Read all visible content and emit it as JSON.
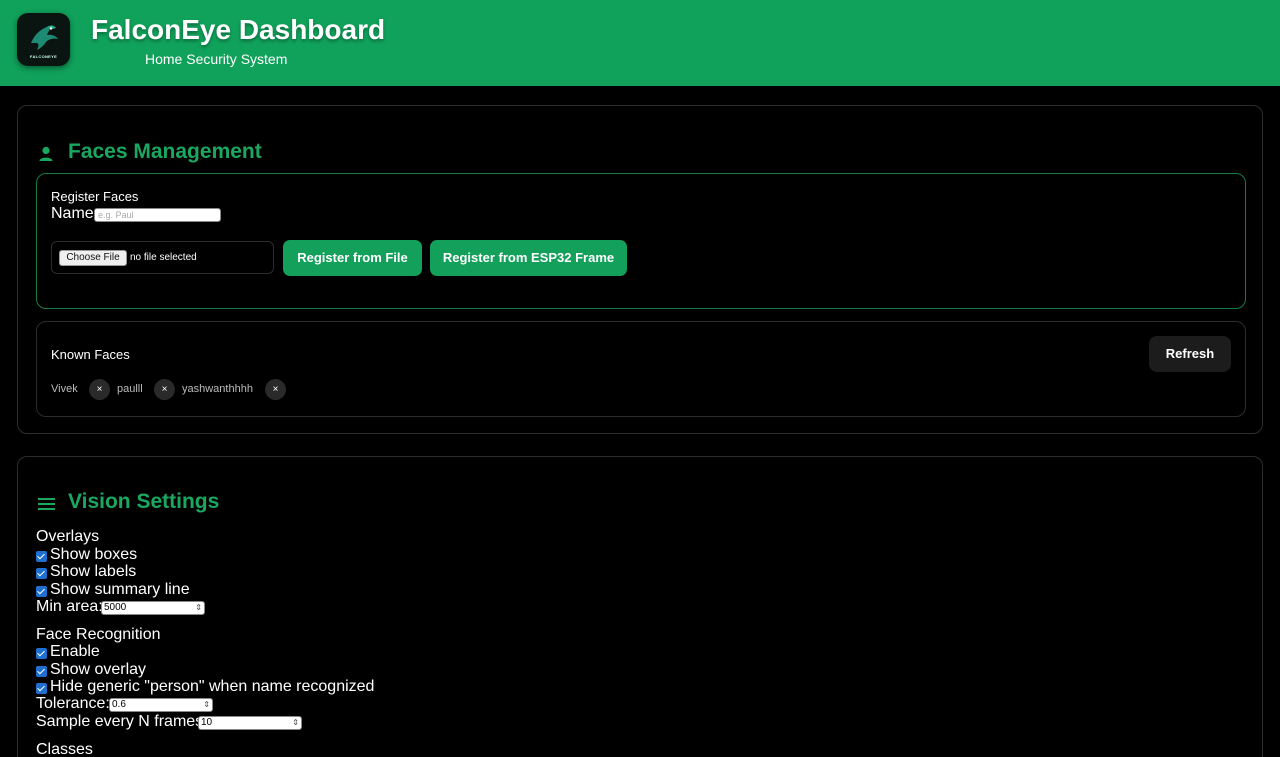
{
  "header": {
    "title": "FalconEye Dashboard",
    "subtitle": "Home Security System",
    "logo_text": "FALCONEYE"
  },
  "faces": {
    "section_title": "Faces Management",
    "icon": "person-icon",
    "register": {
      "heading": "Register Faces",
      "name_label": "Name",
      "name_placeholder": "e.g. Paul",
      "name_value": "",
      "choose_file_label": "Choose File",
      "file_status": "no file selected",
      "register_file_label": "Register from File",
      "register_esp32_label": "Register from ESP32 Frame"
    },
    "known": {
      "heading": "Known Faces",
      "refresh_label": "Refresh",
      "remove_symbol": "×",
      "names": [
        "Vivek",
        "paulll",
        "yashwanthhhh"
      ]
    }
  },
  "vision": {
    "section_title": "Vision Settings",
    "icon": "menu-icon",
    "overlays": {
      "heading": "Overlays",
      "show_boxes": "Show boxes",
      "show_labels": "Show labels",
      "show_summary": "Show summary line",
      "min_area_label": "Min area:",
      "min_area_value": "5000"
    },
    "face_recognition": {
      "heading": "Face Recognition",
      "enable": "Enable",
      "show_overlay": "Show overlay",
      "hide_generic": "Hide generic \"person\" when name recognized",
      "tolerance_label": "Tolerance:",
      "tolerance_value": "0.6",
      "sample_label": "Sample every N frames:",
      "sample_value": "10"
    },
    "classes_heading": "Classes"
  },
  "colors": {
    "header_green": "#10a15a",
    "accent_green": "#1aa860",
    "background": "#000000",
    "checkbox_blue": "#1f6fd1"
  }
}
